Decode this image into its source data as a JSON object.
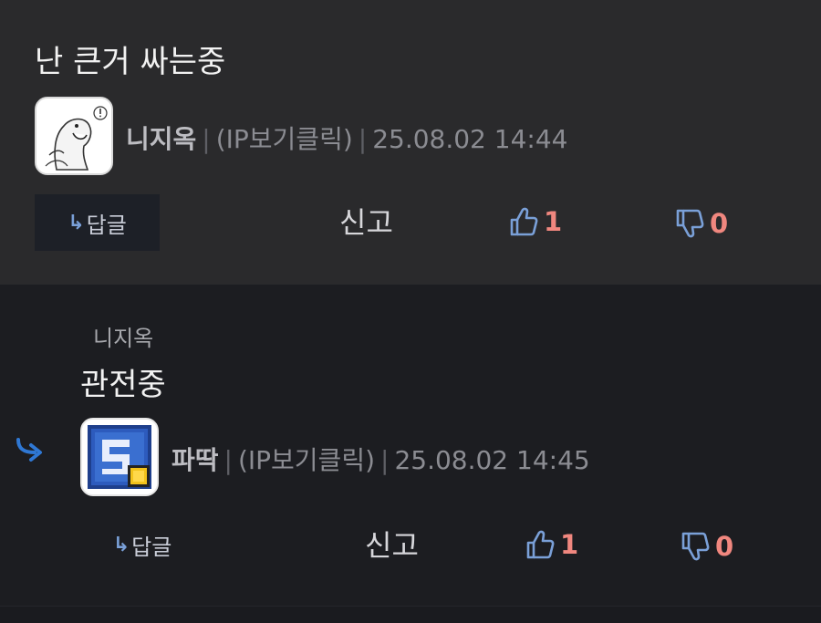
{
  "comments": [
    {
      "body": "난 큰거 싸는중",
      "author": "니지옥",
      "ip": "(IP보기클릭)",
      "timestamp": "25.08.02 14:44",
      "reply_label": "답글",
      "report_label": "신고",
      "upvotes": "1",
      "downvotes": "0",
      "avatar_icon": "cartoon-character-avatar"
    },
    {
      "parent_author": "니지옥",
      "body": "관전중",
      "author": "파딱",
      "ip": "(IP보기클릭)",
      "timestamp": "25.08.02 14:45",
      "reply_label": "답글",
      "report_label": "신고",
      "upvotes": "1",
      "downvotes": "0",
      "avatar_icon": "pixel-badge-avatar"
    }
  ],
  "colors": {
    "top_bg": "#2a2a2c",
    "reply_bg": "#1c1d21",
    "vote_count": "#f0877f",
    "vote_icon": "#7aa0d8",
    "reply_arrow": "#2f78d4"
  }
}
